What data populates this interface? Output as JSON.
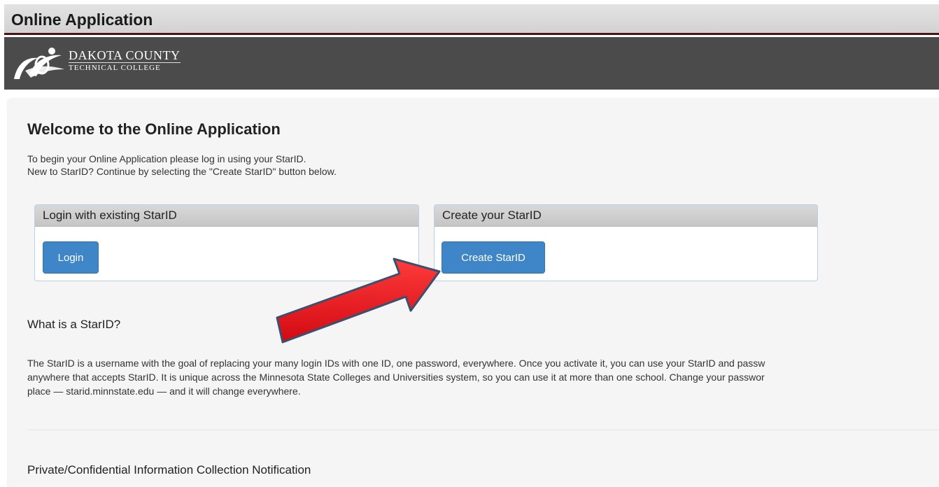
{
  "header": {
    "title": "Online Application"
  },
  "brand": {
    "logo_icon": "dctc-swoosh-logo",
    "name_line1": "DAKOTA COUNTY",
    "name_line2": "TECHNICAL COLLEGE"
  },
  "main": {
    "heading": "Welcome to the Online Application",
    "intro_line1": "To begin your Online Application please log in using your StarID.",
    "intro_line2": "New to StarID? Continue by selecting the \"Create StarID\" button below.",
    "login_panel": {
      "title": "Login with existing StarID",
      "button_label": "Login"
    },
    "create_panel": {
      "title": "Create your StarID",
      "button_label": "Create StarID"
    },
    "annotation_arrow": {
      "icon": "red-arrow-icon",
      "color": "#e8121b"
    },
    "what_heading": "What is a StarID?",
    "what_line1": "The StarID is a username with the goal of replacing your many login IDs with one ID, one password, everywhere. Once you activate it, you can use your StarID and passw",
    "what_line2": "anywhere that accepts StarID. It is unique across the Minnesota State Colleges and Universities system, so you can use it at more than one school. Change your passwor",
    "what_line3": "place — starid.minnstate.edu — and it will change everywhere.",
    "privacy_heading": "Private/Confidential Information Collection Notification"
  },
  "colors": {
    "brand_bar": "#4b4b4b",
    "title_border": "#4a1515",
    "button": "#3e86c7",
    "panel_border": "#b9cfe6"
  }
}
